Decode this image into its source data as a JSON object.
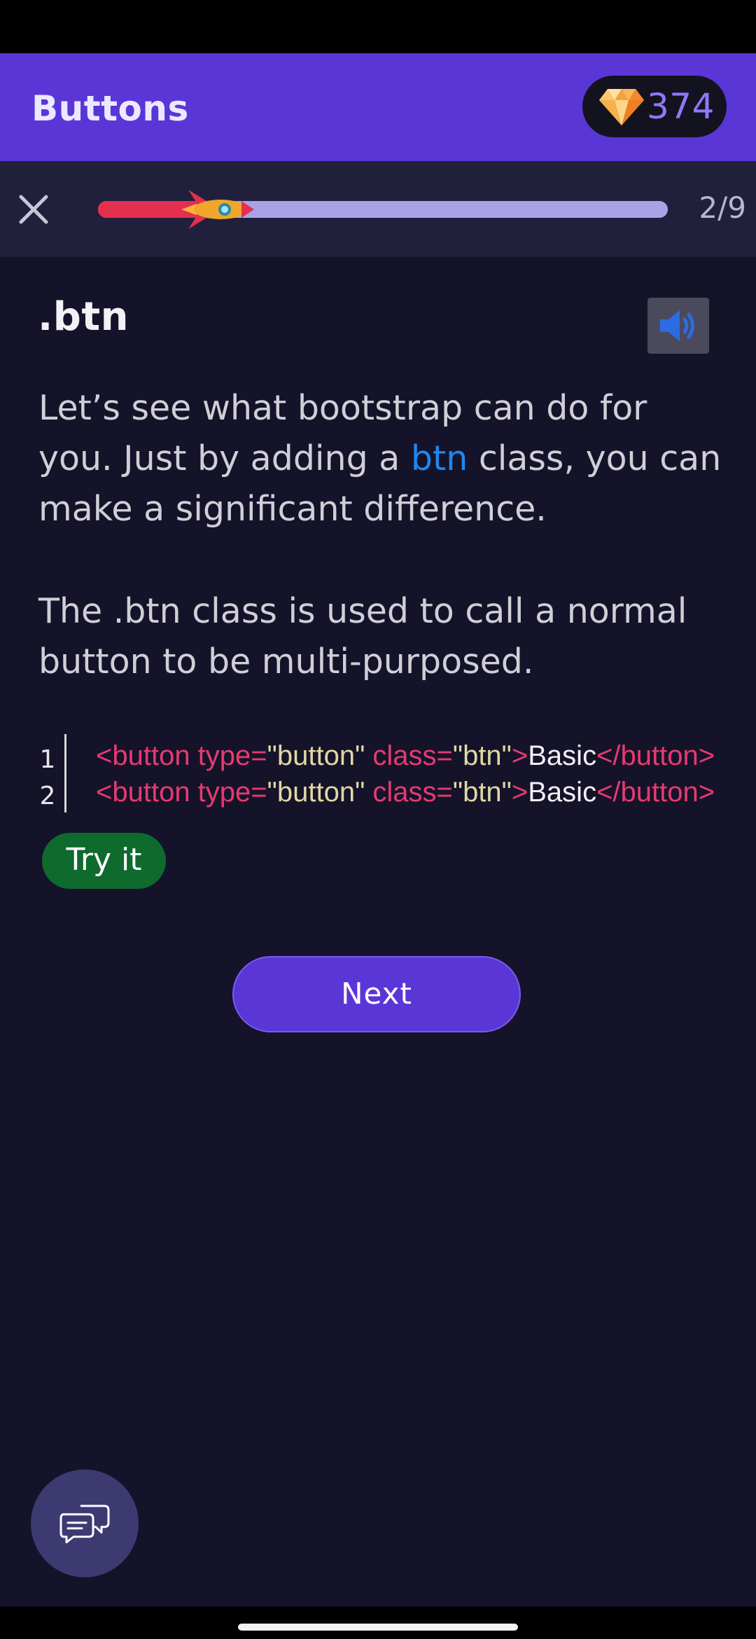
{
  "header": {
    "title": "Buttons",
    "gems": "374",
    "gem_icon": "diamond-icon"
  },
  "progress": {
    "current": 2,
    "total": 9,
    "label": "2/9",
    "fraction": 0.22,
    "close_icon": "close-icon",
    "marker_icon": "rocket-icon"
  },
  "lesson": {
    "title": ".btn",
    "audio_icon": "speaker-icon",
    "paragraph1": {
      "before": "Let’s see what bootstrap can do for you. Just by adding a ",
      "highlight": "btn",
      "after": " class, you can make a significant difference."
    },
    "paragraph2": "The .btn class is used to call a normal button to be multi-purposed."
  },
  "code": {
    "lines": [
      {
        "number": "1",
        "open_tag": "<button type=",
        "type_value": "\"button\"",
        "class_attr": " class=",
        "class_value": "\"btn\"",
        "close_bracket": ">",
        "text": "Basic",
        "end_tag": "</button>"
      },
      {
        "number": "2",
        "open_tag": "<button type=",
        "type_value": "\"button\"",
        "class_attr": " class=",
        "class_value": "\"btn\"",
        "close_bracket": ">",
        "text": "Basic",
        "end_tag": "</button>"
      }
    ]
  },
  "actions": {
    "try_label": "Try it",
    "next_label": "Next",
    "chat_icon": "chat-bubbles-icon"
  },
  "colors": {
    "header_bg": "#5a36d6",
    "page_bg": "#14132a",
    "progress_fill": "#e2304e",
    "progress_track": "#aba2e6",
    "highlight": "#1e88f0",
    "try_button": "#0e6a2d",
    "code_tag": "#e73a6e",
    "code_string": "#e2d7a2"
  }
}
